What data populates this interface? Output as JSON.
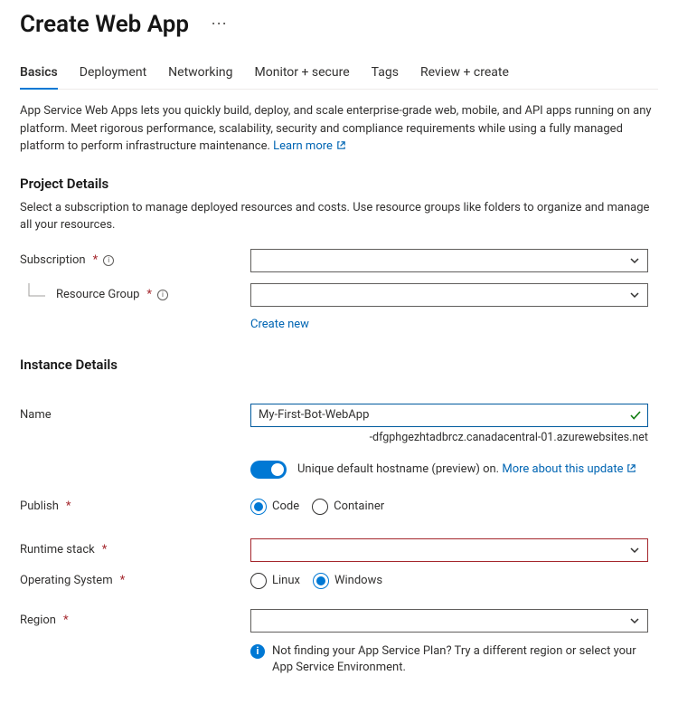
{
  "page": {
    "title": "Create Web App"
  },
  "tabs": [
    {
      "label": "Basics",
      "active": true
    },
    {
      "label": "Deployment",
      "active": false
    },
    {
      "label": "Networking",
      "active": false
    },
    {
      "label": "Monitor + secure",
      "active": false
    },
    {
      "label": "Tags",
      "active": false
    },
    {
      "label": "Review + create",
      "active": false
    }
  ],
  "intro": {
    "text": "App Service Web Apps lets you quickly build, deploy, and scale enterprise-grade web, mobile, and API apps running on any platform. Meet rigorous performance, scalability, security and compliance requirements while using a fully managed platform to perform infrastructure maintenance.  ",
    "learn_more": "Learn more"
  },
  "project_details": {
    "heading": "Project Details",
    "description": "Select a subscription to manage deployed resources and costs. Use resource groups like folders to organize and manage all your resources.",
    "subscription_label": "Subscription",
    "resource_group_label": "Resource Group",
    "create_new": "Create new"
  },
  "instance_details": {
    "heading": "Instance Details",
    "name_label": "Name",
    "name_value": "My-First-Bot-WebApp",
    "hostname_suffix": "-dfgphgezhtadbrcz.canadacentral-01.azurewebsites.net",
    "toggle_label": "Unique default hostname (preview) on. ",
    "toggle_link": "More about this update",
    "publish_label": "Publish",
    "publish_options": {
      "code": "Code",
      "container": "Container",
      "selected": "code"
    },
    "runtime_label": "Runtime stack",
    "os_label": "Operating System",
    "os_options": {
      "linux": "Linux",
      "windows": "Windows",
      "selected": "windows"
    },
    "region_label": "Region",
    "region_hint": "Not finding your App Service Plan? Try a different region or select your App Service Environment."
  }
}
